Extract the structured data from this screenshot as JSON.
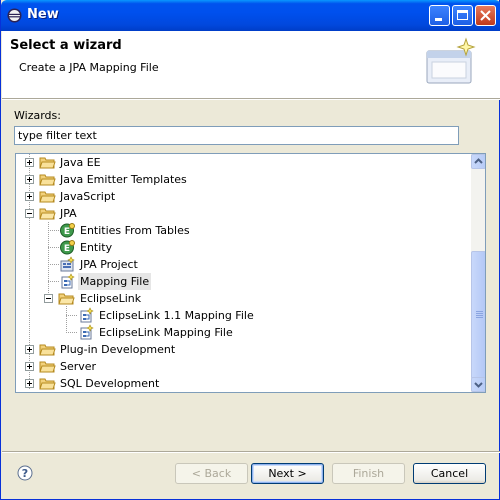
{
  "window": {
    "title": "New"
  },
  "header": {
    "title": "Select a wizard",
    "description": "Create a JPA Mapping File"
  },
  "wizards_label": "Wizards:",
  "filter": {
    "value": "type filter text"
  },
  "tree": {
    "items": [
      {
        "label": "Java EE",
        "expander": "plus",
        "icon": "folder-icon"
      },
      {
        "label": "Java Emitter Templates",
        "expander": "plus",
        "icon": "folder-icon"
      },
      {
        "label": "JavaScript",
        "expander": "plus",
        "icon": "folder-icon"
      },
      {
        "label": "JPA",
        "expander": "minus",
        "icon": "folder-open-icon"
      },
      {
        "label": "Entities From Tables",
        "icon": "entity-icon"
      },
      {
        "label": "Entity",
        "icon": "entity-icon"
      },
      {
        "label": "JPA Project",
        "icon": "jpa-project-icon"
      },
      {
        "label": "Mapping File",
        "icon": "mapping-file-icon",
        "selected": true
      },
      {
        "label": "EclipseLink",
        "expander": "minus",
        "icon": "folder-open-icon"
      },
      {
        "label": "EclipseLink 1.1 Mapping File",
        "icon": "mapping-file-icon"
      },
      {
        "label": "EclipseLink Mapping File",
        "icon": "mapping-file-icon"
      },
      {
        "label": "Plug-in Development",
        "expander": "plus",
        "icon": "folder-icon"
      },
      {
        "label": "Server",
        "expander": "plus",
        "icon": "folder-icon"
      },
      {
        "label": "SQL Development",
        "expander": "plus",
        "icon": "folder-icon"
      }
    ]
  },
  "buttons": {
    "back": "< Back",
    "next": "Next >",
    "finish": "Finish",
    "cancel": "Cancel"
  },
  "colors": {
    "title_bar": "#0050ee",
    "dialog_bg": "#ece9d8",
    "selection_bg": "#e6e6e6"
  }
}
